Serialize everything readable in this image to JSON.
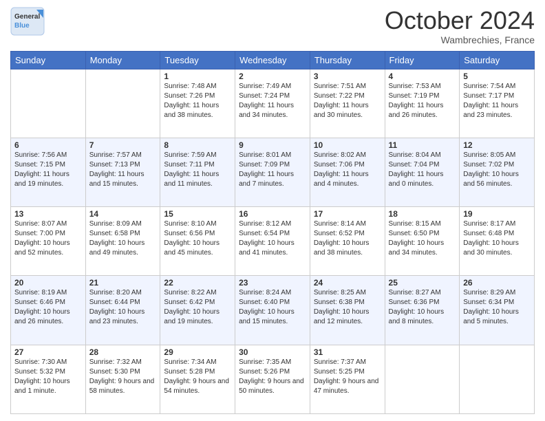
{
  "logo": {
    "line1": "General",
    "line2": "Blue"
  },
  "header": {
    "month": "October 2024",
    "location": "Wambrechies, France"
  },
  "weekdays": [
    "Sunday",
    "Monday",
    "Tuesday",
    "Wednesday",
    "Thursday",
    "Friday",
    "Saturday"
  ],
  "weeks": [
    [
      {
        "day": "",
        "info": ""
      },
      {
        "day": "",
        "info": ""
      },
      {
        "day": "1",
        "info": "Sunrise: 7:48 AM\nSunset: 7:26 PM\nDaylight: 11 hours and 38 minutes."
      },
      {
        "day": "2",
        "info": "Sunrise: 7:49 AM\nSunset: 7:24 PM\nDaylight: 11 hours and 34 minutes."
      },
      {
        "day": "3",
        "info": "Sunrise: 7:51 AM\nSunset: 7:22 PM\nDaylight: 11 hours and 30 minutes."
      },
      {
        "day": "4",
        "info": "Sunrise: 7:53 AM\nSunset: 7:19 PM\nDaylight: 11 hours and 26 minutes."
      },
      {
        "day": "5",
        "info": "Sunrise: 7:54 AM\nSunset: 7:17 PM\nDaylight: 11 hours and 23 minutes."
      }
    ],
    [
      {
        "day": "6",
        "info": "Sunrise: 7:56 AM\nSunset: 7:15 PM\nDaylight: 11 hours and 19 minutes."
      },
      {
        "day": "7",
        "info": "Sunrise: 7:57 AM\nSunset: 7:13 PM\nDaylight: 11 hours and 15 minutes."
      },
      {
        "day": "8",
        "info": "Sunrise: 7:59 AM\nSunset: 7:11 PM\nDaylight: 11 hours and 11 minutes."
      },
      {
        "day": "9",
        "info": "Sunrise: 8:01 AM\nSunset: 7:09 PM\nDaylight: 11 hours and 7 minutes."
      },
      {
        "day": "10",
        "info": "Sunrise: 8:02 AM\nSunset: 7:06 PM\nDaylight: 11 hours and 4 minutes."
      },
      {
        "day": "11",
        "info": "Sunrise: 8:04 AM\nSunset: 7:04 PM\nDaylight: 11 hours and 0 minutes."
      },
      {
        "day": "12",
        "info": "Sunrise: 8:05 AM\nSunset: 7:02 PM\nDaylight: 10 hours and 56 minutes."
      }
    ],
    [
      {
        "day": "13",
        "info": "Sunrise: 8:07 AM\nSunset: 7:00 PM\nDaylight: 10 hours and 52 minutes."
      },
      {
        "day": "14",
        "info": "Sunrise: 8:09 AM\nSunset: 6:58 PM\nDaylight: 10 hours and 49 minutes."
      },
      {
        "day": "15",
        "info": "Sunrise: 8:10 AM\nSunset: 6:56 PM\nDaylight: 10 hours and 45 minutes."
      },
      {
        "day": "16",
        "info": "Sunrise: 8:12 AM\nSunset: 6:54 PM\nDaylight: 10 hours and 41 minutes."
      },
      {
        "day": "17",
        "info": "Sunrise: 8:14 AM\nSunset: 6:52 PM\nDaylight: 10 hours and 38 minutes."
      },
      {
        "day": "18",
        "info": "Sunrise: 8:15 AM\nSunset: 6:50 PM\nDaylight: 10 hours and 34 minutes."
      },
      {
        "day": "19",
        "info": "Sunrise: 8:17 AM\nSunset: 6:48 PM\nDaylight: 10 hours and 30 minutes."
      }
    ],
    [
      {
        "day": "20",
        "info": "Sunrise: 8:19 AM\nSunset: 6:46 PM\nDaylight: 10 hours and 26 minutes."
      },
      {
        "day": "21",
        "info": "Sunrise: 8:20 AM\nSunset: 6:44 PM\nDaylight: 10 hours and 23 minutes."
      },
      {
        "day": "22",
        "info": "Sunrise: 8:22 AM\nSunset: 6:42 PM\nDaylight: 10 hours and 19 minutes."
      },
      {
        "day": "23",
        "info": "Sunrise: 8:24 AM\nSunset: 6:40 PM\nDaylight: 10 hours and 15 minutes."
      },
      {
        "day": "24",
        "info": "Sunrise: 8:25 AM\nSunset: 6:38 PM\nDaylight: 10 hours and 12 minutes."
      },
      {
        "day": "25",
        "info": "Sunrise: 8:27 AM\nSunset: 6:36 PM\nDaylight: 10 hours and 8 minutes."
      },
      {
        "day": "26",
        "info": "Sunrise: 8:29 AM\nSunset: 6:34 PM\nDaylight: 10 hours and 5 minutes."
      }
    ],
    [
      {
        "day": "27",
        "info": "Sunrise: 7:30 AM\nSunset: 5:32 PM\nDaylight: 10 hours and 1 minute."
      },
      {
        "day": "28",
        "info": "Sunrise: 7:32 AM\nSunset: 5:30 PM\nDaylight: 9 hours and 58 minutes."
      },
      {
        "day": "29",
        "info": "Sunrise: 7:34 AM\nSunset: 5:28 PM\nDaylight: 9 hours and 54 minutes."
      },
      {
        "day": "30",
        "info": "Sunrise: 7:35 AM\nSunset: 5:26 PM\nDaylight: 9 hours and 50 minutes."
      },
      {
        "day": "31",
        "info": "Sunrise: 7:37 AM\nSunset: 5:25 PM\nDaylight: 9 hours and 47 minutes."
      },
      {
        "day": "",
        "info": ""
      },
      {
        "day": "",
        "info": ""
      }
    ]
  ]
}
